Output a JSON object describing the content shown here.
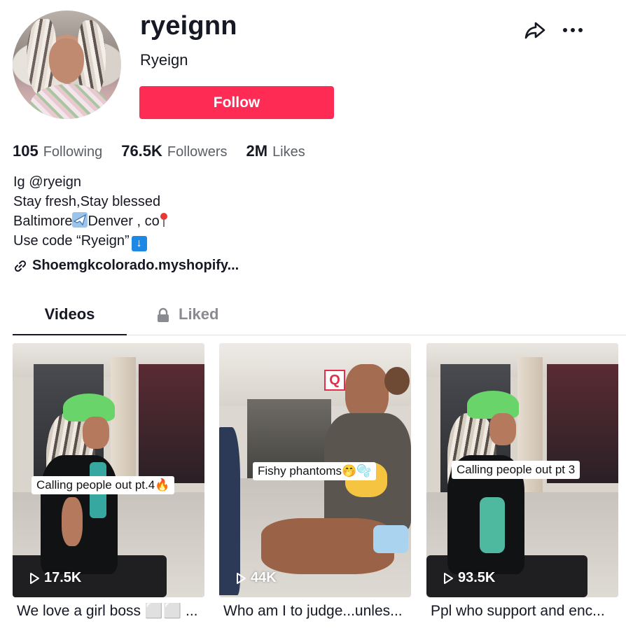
{
  "profile": {
    "username": "ryeignn",
    "display_name": "Ryeign",
    "follow_label": "Follow"
  },
  "stats": [
    {
      "value": "105",
      "label": "Following"
    },
    {
      "value": "76.5K",
      "label": "Followers"
    },
    {
      "value": "2M",
      "label": "Likes"
    }
  ],
  "bio": {
    "line1": "Ig @ryeign",
    "line2": "Stay fresh,Stay blessed",
    "line3_a": "Baltimore",
    "line3_b": "Denver , co",
    "line4": "Use code “Ryeign”",
    "arrow": "↓"
  },
  "link": {
    "text": "Shoemgkcolorado.myshopify..."
  },
  "tabs": [
    {
      "label": "Videos",
      "active": true
    },
    {
      "label": "Liked",
      "locked": true
    }
  ],
  "videos": [
    {
      "overlay": "Calling people out pt.4🔥",
      "views": "17.5K",
      "desc": "We love a girl boss ⬜⬜ ..."
    },
    {
      "overlay": "Fishy phantoms🤭🫧",
      "views": "44K",
      "desc": "Who am I to judge...unles..."
    },
    {
      "overlay": "Calling people out pt 3",
      "views": "93.5K",
      "desc": "Ppl who support and enc..."
    }
  ],
  "colors": {
    "brand": "#fe2c55",
    "text": "#161823",
    "muted": "#5c5e66"
  },
  "icons": [
    "share-icon",
    "more-icon",
    "link-icon",
    "lock-icon",
    "play-icon",
    "airplane-emoji",
    "pin-emoji",
    "down-arrow-emoji"
  ]
}
